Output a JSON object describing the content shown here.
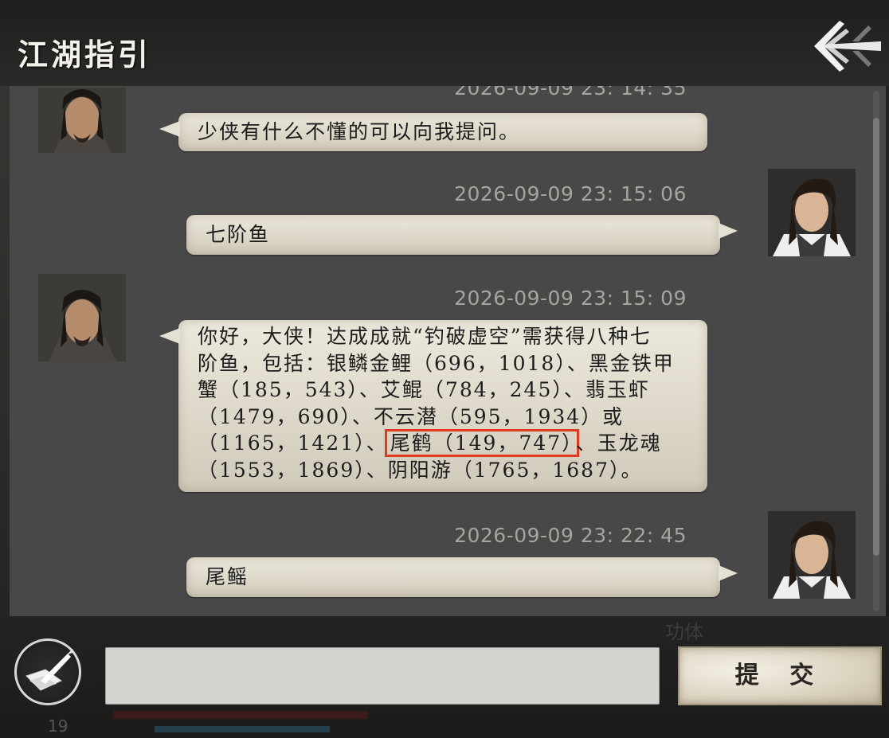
{
  "header": {
    "title": "江湖指引",
    "back_icon": "feather-arrow-back-icon"
  },
  "chat": {
    "messages": [
      {
        "sender": "npc",
        "timestamp": "2026-09-09 23: 14: 35",
        "lines": [
          "少侠有什么不懂的可以向我提问。"
        ]
      },
      {
        "sender": "player",
        "timestamp": "2026-09-09 23: 15: 06",
        "lines": [
          "七阶鱼"
        ]
      },
      {
        "sender": "npc",
        "timestamp": "2026-09-09 23: 15: 09",
        "lines": [
          "你好，大侠！达成成就“钓破虚空”需获得八种七",
          "阶鱼，包括：银鳞金鲤（696，1018）、黑金铁甲",
          "蟹（185，543）、艾鲲（784，245）、翡玉虾",
          "（1479，690）、不云潜（595，1934）或",
          "（1165，1421）、",
          "尾鹤（149，747）",
          "、玉龙魂",
          "（1553，1869）、阴阳游（1765，1687）。"
        ]
      },
      {
        "sender": "player",
        "timestamp": "2026-09-09 23: 22: 45",
        "lines": [
          "尾鳐"
        ]
      }
    ]
  },
  "input": {
    "compose_icon": "paper-feather-quill-icon",
    "value": "",
    "placeholder": "",
    "submit_label": "提 交"
  },
  "background": {
    "deco_text": "功体",
    "level_number": "19"
  },
  "colors": {
    "panel": "#484848",
    "bubble": "#e4e0d3",
    "highlight": "#e03a22",
    "timestamp": "#a7a49d"
  }
}
